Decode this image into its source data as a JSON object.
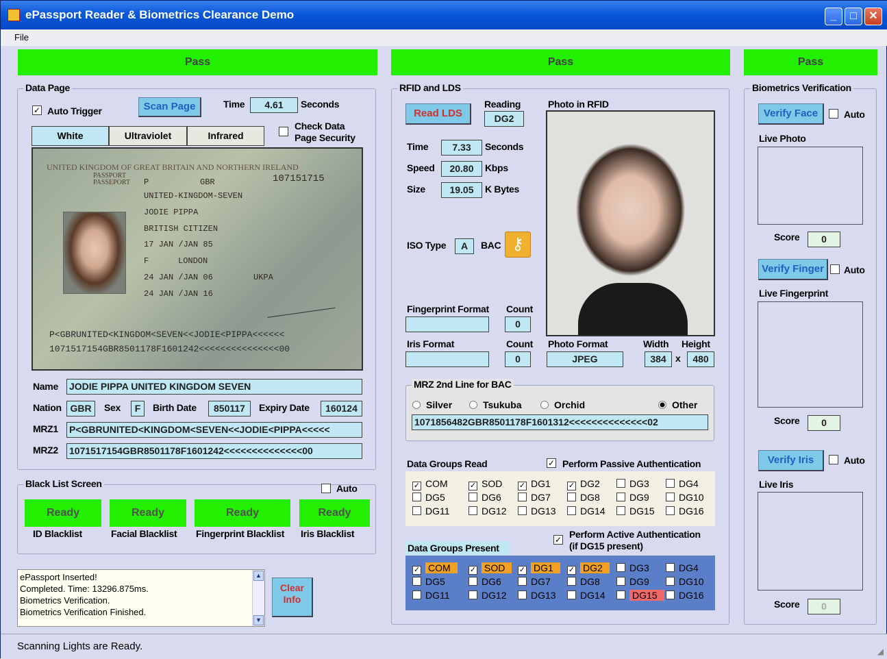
{
  "window": {
    "title": "ePassport Reader & Biometrics Clearance Demo"
  },
  "menu": {
    "file": "File"
  },
  "pass_banners": [
    "Pass",
    "Pass",
    "Pass"
  ],
  "data_page": {
    "group_label": "Data Page",
    "auto_trigger_label": "Auto Trigger",
    "auto_trigger_checked": true,
    "scan_button": "Scan Page",
    "time_label": "Time",
    "time_value": "4.61",
    "seconds_label": "Seconds",
    "tabs": [
      "White",
      "Ultraviolet",
      "Infrared"
    ],
    "check_security_label_1": "Check Data",
    "check_security_label_2": "Page Security",
    "passport_image": {
      "header": "UNITED KINGDOM OF GREAT BRITAIN AND NORTHERN IRELAND",
      "doc_type_1": "PASSPORT",
      "doc_type_2": "PASSEPORT",
      "type": "P",
      "code": "GBR",
      "number": "107151715",
      "surname": "UNITED-KINGDOM-SEVEN",
      "given": "JODIE PIPPA",
      "nationality": "BRITISH CITIZEN",
      "dob": "17 JAN /JAN 85",
      "sex": "F",
      "pob": "LONDON",
      "issue": "24 JAN /JAN 06",
      "authority": "UKPA",
      "expiry": "24 JAN /JAN 16",
      "mrz1": "P<GBRUNITED<KINGDOM<SEVEN<<JODIE<PIPPA<<<<<<",
      "mrz2": "1071517154GBR8501178F1601242<<<<<<<<<<<<<<<00"
    },
    "name_label": "Name",
    "name_value": "JODIE PIPPA UNITED KINGDOM SEVEN",
    "nation_label": "Nation",
    "nation_value": "GBR",
    "sex_label": "Sex",
    "sex_value": "F",
    "birth_label": "Birth Date",
    "birth_value": "850117",
    "expiry_label": "Expiry Date",
    "expiry_value": "160124",
    "mrz1_label": "MRZ1",
    "mrz1_value": "P<GBRUNITED<KINGDOM<SEVEN<<JODIE<PIPPA<<<<<",
    "mrz2_label": "MRZ2",
    "mrz2_value": "1071517154GBR8501178F1601242<<<<<<<<<<<<<<00"
  },
  "blacklist": {
    "group_label": "Black List Screen",
    "auto_label": "Auto",
    "items": [
      {
        "status": "Ready",
        "label": "ID Blacklist"
      },
      {
        "status": "Ready",
        "label": "Facial Blacklist"
      },
      {
        "status": "Ready",
        "label": "Fingerprint Blacklist"
      },
      {
        "status": "Ready",
        "label": "Iris Blacklist"
      }
    ]
  },
  "info": {
    "lines": [
      "ePassport Inserted!",
      "Completed. Time: 13296.875ms.",
      "Biometrics Verification.",
      "Biometrics Verification Finished."
    ],
    "clear_1": "Clear",
    "clear_2": "Info"
  },
  "rfid": {
    "group_label": "RFID and LDS",
    "read_button": "Read LDS",
    "reading_label": "Reading",
    "reading_value": "DG2",
    "photo_label": "Photo in RFID",
    "time_label": "Time",
    "time_value": "7.33",
    "seconds_label": "Seconds",
    "speed_label": "Speed",
    "speed_value": "20.80",
    "kbps_label": "Kbps",
    "size_label": "Size",
    "size_value": "19.05",
    "kbytes_label": "K Bytes",
    "iso_label": "ISO Type",
    "iso_value": "A",
    "bac_label": "BAC",
    "fp_format_label": "Fingerprint Format",
    "fp_count_label": "Count",
    "fp_count_value": "0",
    "iris_format_label": "Iris Format",
    "iris_count_label": "Count",
    "iris_count_value": "0",
    "photo_format_label": "Photo Format",
    "photo_format_value": "JPEG",
    "width_label": "Width",
    "height_label": "Height",
    "width_value": "384",
    "x_label": "x",
    "height_value": "480",
    "mrz_group_label": "MRZ 2nd Line for BAC",
    "radios": [
      {
        "label": "Silver",
        "checked": false
      },
      {
        "label": "Tsukuba",
        "checked": false
      },
      {
        "label": "Orchid",
        "checked": false
      },
      {
        "label": "Other",
        "checked": true
      }
    ],
    "mrz_line_value": "1071856482GBR8501178F1601312<<<<<<<<<<<<<<02",
    "dg_read_label": "Data Groups Read",
    "passive_auth_label": "Perform Passive Authentication",
    "dg_read": [
      {
        "name": "COM",
        "checked": true
      },
      {
        "name": "SOD",
        "checked": true
      },
      {
        "name": "DG1",
        "checked": true
      },
      {
        "name": "DG2",
        "checked": true
      },
      {
        "name": "DG3",
        "checked": false
      },
      {
        "name": "DG4",
        "checked": false
      },
      {
        "name": "DG5",
        "checked": false
      },
      {
        "name": "DG6",
        "checked": false
      },
      {
        "name": "DG7",
        "checked": false
      },
      {
        "name": "DG8",
        "checked": false
      },
      {
        "name": "DG9",
        "checked": false
      },
      {
        "name": "DG10",
        "checked": false
      },
      {
        "name": "DG11",
        "checked": false
      },
      {
        "name": "DG12",
        "checked": false
      },
      {
        "name": "DG13",
        "checked": false
      },
      {
        "name": "DG14",
        "checked": false
      },
      {
        "name": "DG15",
        "checked": false
      },
      {
        "name": "DG16",
        "checked": false
      }
    ],
    "dg_present_label": "Data Groups Present",
    "active_auth_label_1": "Perform Active Authentication",
    "active_auth_label_2": "(if DG15 present)",
    "dg_present": [
      {
        "name": "COM",
        "checked": true,
        "hl": "#f5a020"
      },
      {
        "name": "SOD",
        "checked": true,
        "hl": "#f5a020"
      },
      {
        "name": "DG1",
        "checked": true,
        "hl": "#f5a020"
      },
      {
        "name": "DG2",
        "checked": true,
        "hl": "#f5a020"
      },
      {
        "name": "DG3",
        "checked": false,
        "hl": ""
      },
      {
        "name": "DG4",
        "checked": false,
        "hl": ""
      },
      {
        "name": "DG5",
        "checked": false,
        "hl": ""
      },
      {
        "name": "DG6",
        "checked": false,
        "hl": ""
      },
      {
        "name": "DG7",
        "checked": false,
        "hl": ""
      },
      {
        "name": "DG8",
        "checked": false,
        "hl": ""
      },
      {
        "name": "DG9",
        "checked": false,
        "hl": ""
      },
      {
        "name": "DG10",
        "checked": false,
        "hl": ""
      },
      {
        "name": "DG11",
        "checked": false,
        "hl": ""
      },
      {
        "name": "DG12",
        "checked": false,
        "hl": ""
      },
      {
        "name": "DG13",
        "checked": false,
        "hl": ""
      },
      {
        "name": "DG14",
        "checked": false,
        "hl": ""
      },
      {
        "name": "DG15",
        "checked": false,
        "hl": "#f06868"
      },
      {
        "name": "DG16",
        "checked": false,
        "hl": ""
      }
    ]
  },
  "biometrics": {
    "group_label": "Biometrics Verification",
    "verify_face": "Verify Face",
    "verify_finger": "Verify Finger",
    "verify_iris": "Verify Iris",
    "auto_label": "Auto",
    "live_photo": "Live Photo",
    "live_fingerprint": "Live Fingerprint",
    "live_iris": "Live Iris",
    "score_label": "Score",
    "scores": [
      "0",
      "0",
      "0"
    ]
  },
  "status": {
    "text": "Scanning Lights are Ready."
  }
}
